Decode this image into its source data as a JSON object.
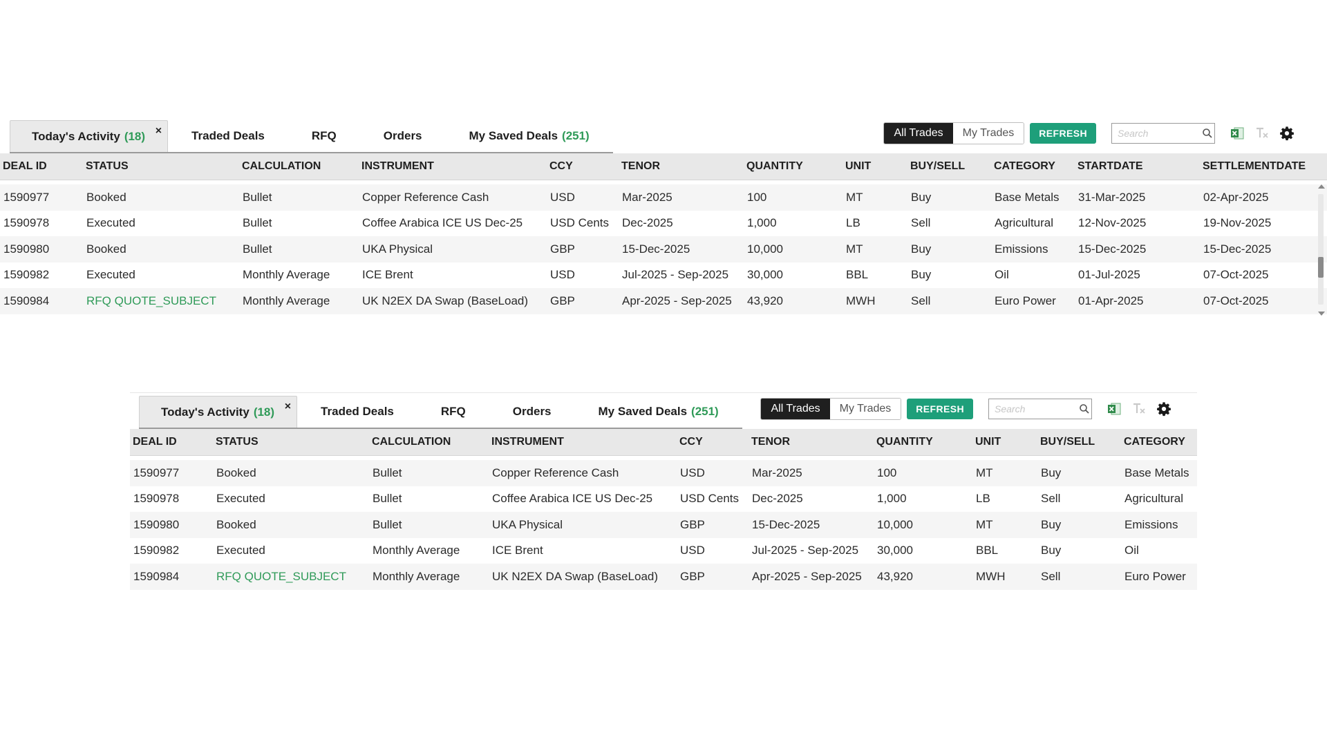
{
  "tabs": [
    {
      "label": "Today's Activity",
      "count": "(18)",
      "close": "×",
      "active": true
    },
    {
      "label": "Traded Deals"
    },
    {
      "label": "RFQ"
    },
    {
      "label": "Orders"
    },
    {
      "label": "My Saved Deals",
      "count": "(251)"
    }
  ],
  "controls": {
    "all_trades": "All Trades",
    "my_trades": "My Trades",
    "refresh": "REFRESH",
    "search_placeholder": "Search"
  },
  "colors": {
    "accent_green": "#1e9f7a",
    "count_green": "#2f9a58",
    "toggle_active": "#1f1f1f"
  },
  "icons": [
    "search-icon",
    "excel-export-icon",
    "clear-filter-icon",
    "gear-icon"
  ],
  "columns_top": [
    "DEAL ID",
    "STATUS",
    "CALCULATION",
    "INSTRUMENT",
    "CCY",
    "TENOR",
    "QUANTITY",
    "UNIT",
    "BUY/SELL",
    "CATEGORY",
    "STARTDATE",
    "SETTLEMENTDATE"
  ],
  "columns_bottom": [
    "DEAL ID",
    "STATUS",
    "CALCULATION",
    "INSTRUMENT",
    "CCY",
    "TENOR",
    "QUANTITY",
    "UNIT",
    "BUY/SELL",
    "CATEGORY"
  ],
  "rows": [
    {
      "deal_id": "1590977",
      "status": "Booked",
      "calculation": "Bullet",
      "instrument": "Copper Reference Cash",
      "ccy": "USD",
      "tenor": "Mar-2025",
      "quantity": "100",
      "unit": "MT",
      "buy_sell": "Buy",
      "category": "Base Metals",
      "startdate": "31-Mar-2025",
      "settlementdate": "02-Apr-2025"
    },
    {
      "deal_id": "1590978",
      "status": "Executed",
      "calculation": "Bullet",
      "instrument": "Coffee Arabica ICE US Dec-25",
      "ccy": "USD Cents",
      "tenor": "Dec-2025",
      "quantity": "1,000",
      "unit": "LB",
      "buy_sell": "Sell",
      "category": "Agricultural",
      "startdate": "12-Nov-2025",
      "settlementdate": "19-Nov-2025"
    },
    {
      "deal_id": "1590980",
      "status": "Booked",
      "calculation": "Bullet",
      "instrument": "UKA Physical",
      "ccy": "GBP",
      "tenor": "15-Dec-2025",
      "quantity": "10,000",
      "unit": "MT",
      "buy_sell": "Buy",
      "category": "Emissions",
      "startdate": "15-Dec-2025",
      "settlementdate": "15-Dec-2025"
    },
    {
      "deal_id": "1590982",
      "status": "Executed",
      "calculation": "Monthly Average",
      "instrument": "ICE Brent",
      "ccy": "USD",
      "tenor": "Jul-2025 - Sep-2025",
      "quantity": "30,000",
      "unit": "BBL",
      "buy_sell": "Buy",
      "category": "Oil",
      "startdate": "01-Jul-2025",
      "settlementdate": "07-Oct-2025"
    },
    {
      "deal_id": "1590984",
      "status": "RFQ QUOTE_SUBJECT",
      "status_highlight": true,
      "calculation": "Monthly Average",
      "instrument": "UK N2EX DA Swap (BaseLoad)",
      "ccy": "GBP",
      "tenor": "Apr-2025 - Sep-2025",
      "quantity": "43,920",
      "unit": "MWH",
      "buy_sell": "Sell",
      "category": "Euro Power",
      "startdate": "01-Apr-2025",
      "settlementdate": "07-Oct-2025"
    }
  ]
}
